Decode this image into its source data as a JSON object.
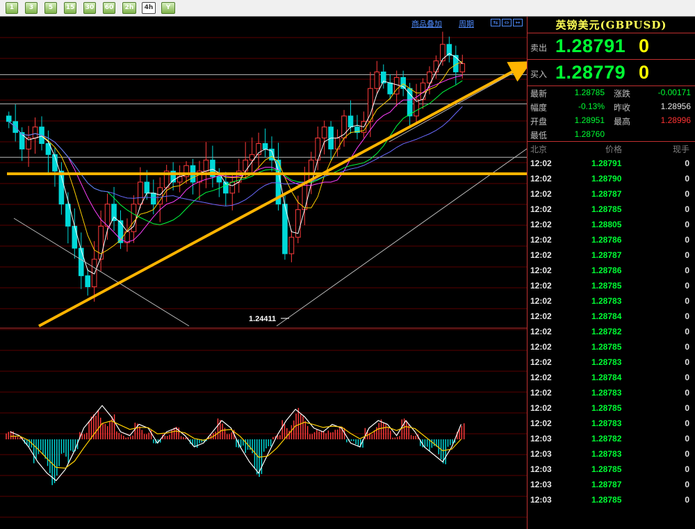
{
  "toolbar": {
    "buttons": [
      "1",
      "3",
      "5",
      "15",
      "30",
      "60",
      "2h",
      "4h",
      "Y"
    ],
    "selected": "4h"
  },
  "chart_links": {
    "overlay": "商品叠加",
    "period": "周期"
  },
  "panel": {
    "title": "英镑美元(GBPUSD)",
    "sell": {
      "label": "卖出",
      "price": "1.28791",
      "volume": "0"
    },
    "buy": {
      "label": "买入",
      "price": "1.28779",
      "volume": "0"
    },
    "stats": {
      "latest_label": "最新",
      "latest": "1.28785",
      "change_label": "涨跌",
      "change": "-0.00171",
      "amp_label": "幅度",
      "amp": "-0.13%",
      "prev_close_label": "昨收",
      "prev_close": "1.28956",
      "open_label": "开盘",
      "open": "1.28951",
      "high_label": "最高",
      "high": "1.28996",
      "low_label": "最低",
      "low": "1.28760"
    },
    "ticks_header": {
      "location": "北京",
      "price": "价格",
      "volume": "现手"
    },
    "ticks": [
      {
        "time": "12:02",
        "price": "1.28791",
        "vol": "0"
      },
      {
        "time": "12:02",
        "price": "1.28790",
        "vol": "0"
      },
      {
        "time": "12:02",
        "price": "1.28787",
        "vol": "0"
      },
      {
        "time": "12:02",
        "price": "1.28785",
        "vol": "0"
      },
      {
        "time": "12:02",
        "price": "1.28805",
        "vol": "0"
      },
      {
        "time": "12:02",
        "price": "1.28786",
        "vol": "0"
      },
      {
        "time": "12:02",
        "price": "1.28787",
        "vol": "0"
      },
      {
        "time": "12:02",
        "price": "1.28786",
        "vol": "0"
      },
      {
        "time": "12:02",
        "price": "1.28785",
        "vol": "0"
      },
      {
        "time": "12:02",
        "price": "1.28783",
        "vol": "0"
      },
      {
        "time": "12:02",
        "price": "1.28784",
        "vol": "0"
      },
      {
        "time": "12:02",
        "price": "1.28782",
        "vol": "0"
      },
      {
        "time": "12:02",
        "price": "1.28785",
        "vol": "0"
      },
      {
        "time": "12:02",
        "price": "1.28783",
        "vol": "0"
      },
      {
        "time": "12:02",
        "price": "1.28784",
        "vol": "0"
      },
      {
        "time": "12:02",
        "price": "1.28783",
        "vol": "0"
      },
      {
        "time": "12:02",
        "price": "1.28785",
        "vol": "0"
      },
      {
        "time": "12:02",
        "price": "1.28783",
        "vol": "0"
      },
      {
        "time": "12:03",
        "price": "1.28782",
        "vol": "0"
      },
      {
        "time": "12:03",
        "price": "1.28783",
        "vol": "0"
      },
      {
        "time": "12:03",
        "price": "1.28785",
        "vol": "0"
      },
      {
        "time": "12:03",
        "price": "1.28787",
        "vol": "0"
      },
      {
        "time": "12:03",
        "price": "1.28785",
        "vol": "0"
      }
    ]
  },
  "chart_data": {
    "type": "candlestick",
    "instrument": "GBPUSD",
    "annotation_low": "1.24411",
    "price_range": [
      1.2395,
      1.2935
    ],
    "close_series": [
      1.277,
      1.275,
      1.272,
      1.274,
      1.276,
      1.273,
      1.271,
      1.268,
      1.262,
      1.258,
      1.254,
      1.249,
      1.247,
      1.252,
      1.258,
      1.262,
      1.259,
      1.255,
      1.257,
      1.262,
      1.266,
      1.264,
      1.262,
      1.265,
      1.268,
      1.266,
      1.267,
      1.269,
      1.266,
      1.268,
      1.27,
      1.267,
      1.266,
      1.264,
      1.266,
      1.268,
      1.27,
      1.271,
      1.273,
      1.272,
      1.27,
      1.262,
      1.253,
      1.256,
      1.261,
      1.266,
      1.27,
      1.274,
      1.276,
      1.272,
      1.274,
      1.278,
      1.276,
      1.275,
      1.277,
      1.283,
      1.286,
      1.284,
      1.282,
      1.285,
      1.283,
      1.278,
      1.281,
      1.284,
      1.286,
      1.288,
      1.291,
      1.289,
      1.286,
      1.2875
    ],
    "macd": {
      "histogram": [
        0.2,
        0.1,
        -0.2,
        -0.6,
        -0.9,
        -1.1,
        -0.8,
        -0.3,
        0.3,
        0.6,
        0.9,
        0.6,
        0.2,
        0.1,
        0.4,
        0.3,
        -0.1,
        0.2,
        0.3,
        0.1,
        -0.2,
        -0.1,
        0.2,
        0.5,
        0.3,
        -0.2,
        -0.6,
        -0.9,
        -0.4,
        0.1,
        0.5,
        0.8,
        0.6,
        0.3,
        0.2,
        0.4,
        0.3,
        -0.1,
        -0.2,
        0.3,
        0.5,
        0.4,
        0.1,
        0.5,
        0.2,
        -0.2,
        -0.4,
        -0.6,
        -0.2,
        0.4
      ],
      "lines": [
        "DIFF",
        "DEA"
      ]
    },
    "reference_levels": [
      1.2855,
      1.2802,
      1.2705
    ]
  }
}
